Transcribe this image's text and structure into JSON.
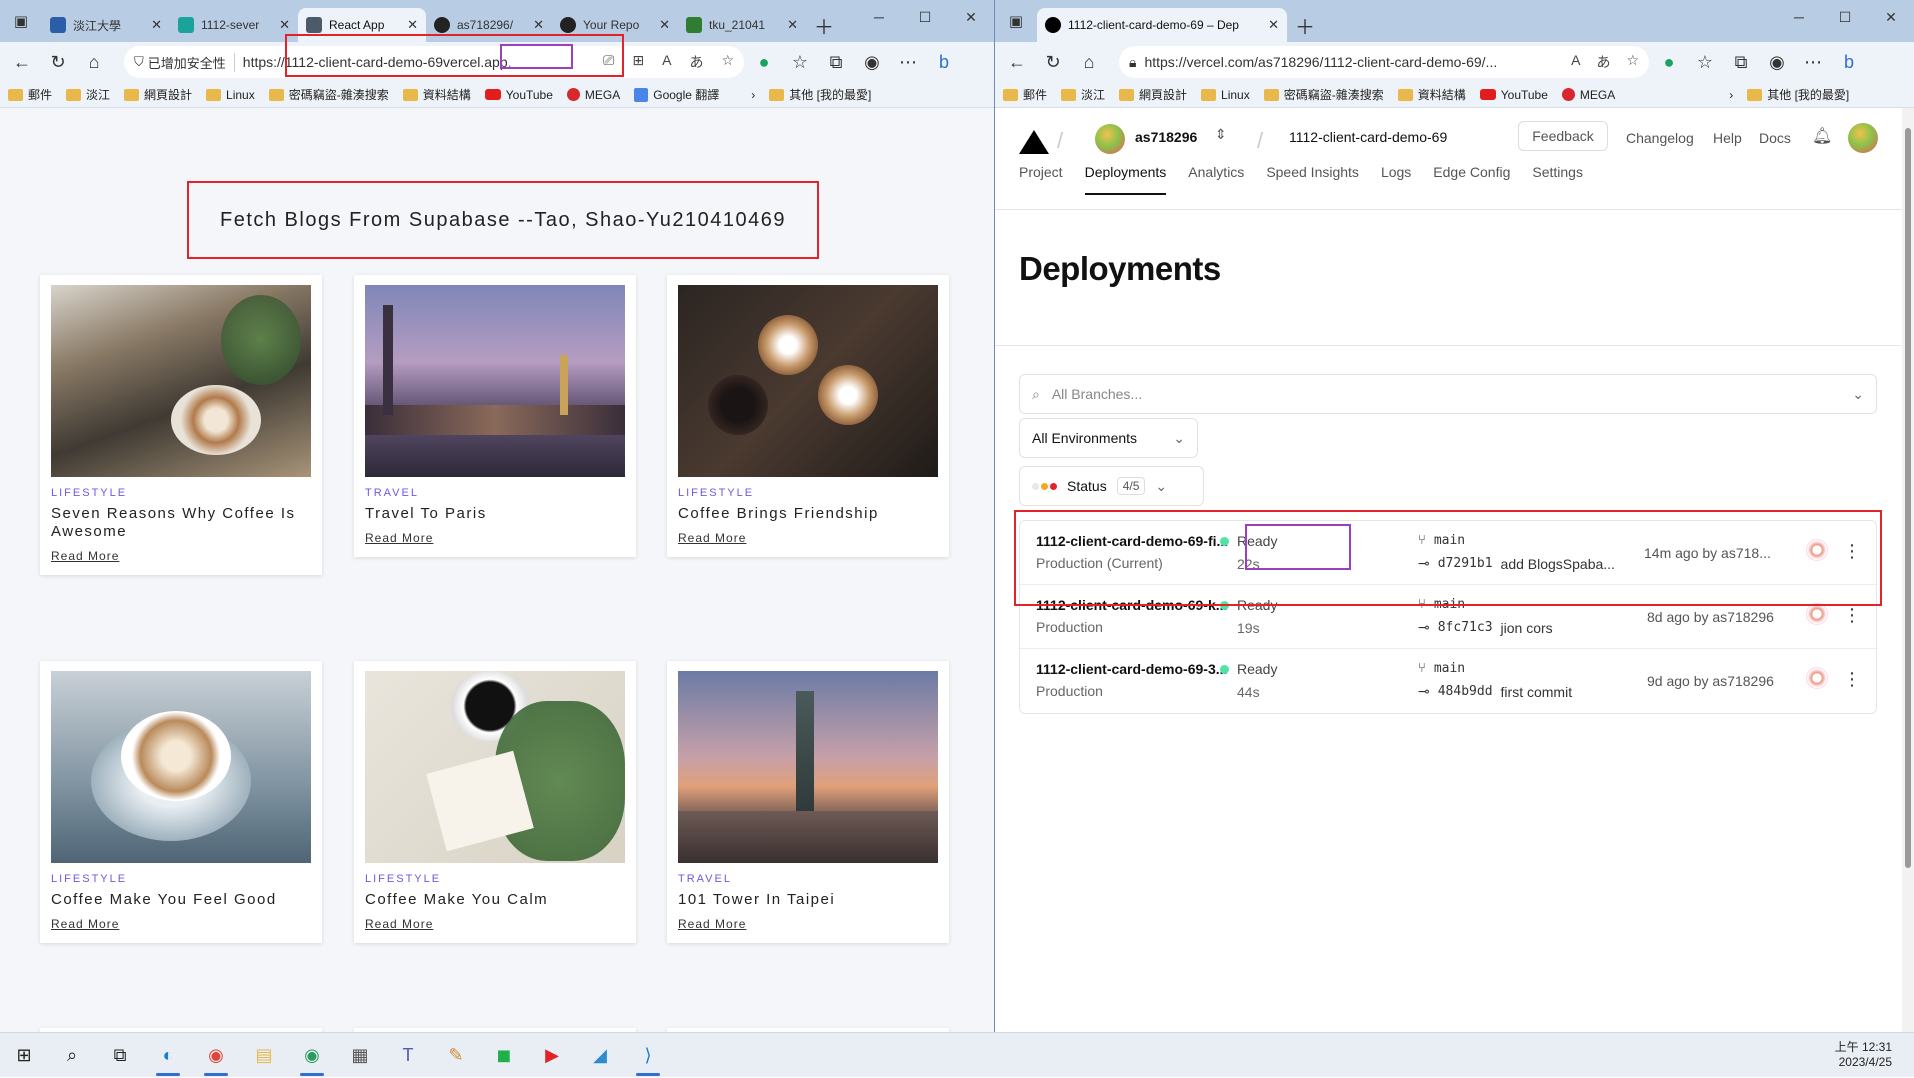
{
  "left_window": {
    "tabs": [
      {
        "label": "淡江大學",
        "color": "#2b5ea8"
      },
      {
        "label": "1112-sever",
        "color": "#1aa39a"
      },
      {
        "label": "React App",
        "color": "#4d5a6a"
      },
      {
        "label": "as718296/",
        "color": "#222222"
      },
      {
        "label": "Your Repo",
        "color": "#222222"
      },
      {
        "label": "tku_21041",
        "color": "#2e7d32"
      }
    ],
    "active_tab": "React App",
    "security_label": "已增加安全性",
    "url_prefix": "https://1112-client-card-demo-69",
    "url_highlight": "vercel.app",
    "bookmarks": [
      "郵件",
      "淡江",
      "網頁設計",
      "Linux",
      "密碼竊盜-雜湊搜索",
      "資料結構",
      "YouTube",
      "MEGA",
      "Google 翻譯",
      "其他 [我的最愛]"
    ],
    "page_title": "Fetch Blogs From Supabase --Tao, Shao-Yu210410469",
    "cards": [
      {
        "category": "LIFESTYLE",
        "title": "Seven Reasons Why Coffee Is Awesome",
        "link": "Read More",
        "image": "coffee-cups-plants"
      },
      {
        "category": "TRAVEL",
        "title": "Travel To Paris",
        "link": "Read More",
        "image": "paris-bridge-dusk"
      },
      {
        "category": "LIFESTYLE",
        "title": "Coffee Brings Friendship",
        "link": "Read More",
        "image": "coffee-cheers"
      },
      {
        "category": "LIFESTYLE",
        "title": "Coffee Make You Feel Good",
        "link": "Read More",
        "image": "latte-art-cup"
      },
      {
        "category": "LIFESTYLE",
        "title": "Coffee Make You Calm",
        "link": "Read More",
        "image": "coffee-leaves-note"
      },
      {
        "category": "TRAVEL",
        "title": "101 Tower In Taipei",
        "link": "Read More",
        "image": "taipei-101-skyline"
      }
    ]
  },
  "right_window": {
    "tab_title": "1112-client-card-demo-69 – Dep",
    "url": "https://vercel.com/as718296/1112-client-card-demo-69/...",
    "bookmarks": [
      "郵件",
      "淡江",
      "網頁設計",
      "Linux",
      "密碼竊盜-雜湊搜索",
      "資料結構",
      "YouTube",
      "MEGA",
      "其他 [我的最愛]"
    ],
    "header": {
      "team": "as718296",
      "project": "1112-client-card-demo-69",
      "feedback": "Feedback",
      "links": [
        "Changelog",
        "Help",
        "Docs"
      ]
    },
    "nav_tabs": [
      "Project",
      "Deployments",
      "Analytics",
      "Speed Insights",
      "Logs",
      "Edge Config",
      "Settings"
    ],
    "active_nav": "Deployments",
    "heading": "Deployments",
    "search_placeholder": "All Branches...",
    "env_filter": "All Environments",
    "status_filter": {
      "label": "Status",
      "count": "4/5"
    },
    "deployments": [
      {
        "name": "1112-client-card-demo-69-fi...",
        "env": "Production (Current)",
        "status": "Ready",
        "duration": "22s",
        "branch": "main",
        "commit": "d7291b1",
        "message": "add BlogsSpaba...",
        "time": "14m ago by as718..."
      },
      {
        "name": "1112-client-card-demo-69-k...",
        "env": "Production",
        "status": "Ready",
        "duration": "19s",
        "branch": "main",
        "commit": "8fc71c3",
        "message": "jion cors",
        "time": "8d ago by as718296"
      },
      {
        "name": "1112-client-card-demo-69-3...",
        "env": "Production",
        "status": "Ready",
        "duration": "44s",
        "branch": "main",
        "commit": "484b9dd",
        "message": "first commit",
        "time": "9d ago by as718296"
      }
    ]
  },
  "taskbar": {
    "time": "上午 12:31",
    "date": "2023/4/25",
    "apps": [
      "start",
      "search",
      "task-view",
      "edge",
      "chrome",
      "file-explorer",
      "chrome-profile",
      "calculator",
      "teams",
      "paint",
      "line",
      "media-player",
      "azure-data",
      "vscode"
    ]
  },
  "colors": {
    "accent_red": "#e2232a",
    "accent_purple": "#9b3fc1",
    "ready_green": "#50e3a4",
    "category_purple": "#6a5be0"
  }
}
